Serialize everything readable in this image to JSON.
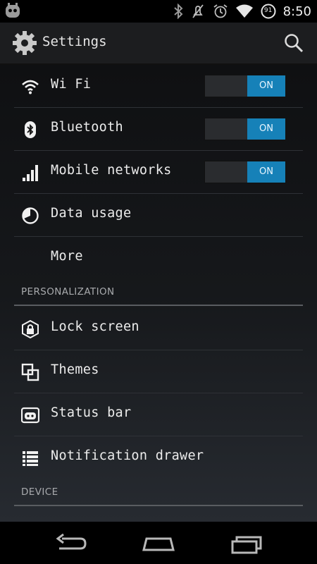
{
  "status_bar": {
    "battery_level": "91",
    "time": "8:50",
    "icons": [
      "cyanogen-icon",
      "bluetooth-icon",
      "mute-icon",
      "alarm-icon",
      "wifi-icon",
      "battery-icon"
    ]
  },
  "action_bar": {
    "title": "Settings",
    "app_icon": "gear-icon",
    "search_icon": "search-icon"
  },
  "wireless": {
    "items": [
      {
        "label": "Wi Fi",
        "icon": "wifi-icon",
        "toggle": "ON"
      },
      {
        "label": "Bluetooth",
        "icon": "bluetooth-icon",
        "toggle": "ON"
      },
      {
        "label": "Mobile networks",
        "icon": "signal-icon",
        "toggle": "ON"
      },
      {
        "label": "Data usage",
        "icon": "data-usage-icon"
      },
      {
        "label": "More"
      }
    ]
  },
  "personalization": {
    "header": "PERSONALIZATION",
    "items": [
      {
        "label": "Lock screen",
        "icon": "lock-icon"
      },
      {
        "label": "Themes",
        "icon": "themes-icon"
      },
      {
        "label": "Status bar",
        "icon": "status-bar-icon"
      },
      {
        "label": "Notification drawer",
        "icon": "list-icon"
      }
    ]
  },
  "device": {
    "header": "DEVICE"
  },
  "nav_bar": {
    "icons": [
      "back-icon",
      "home-icon",
      "recents-icon"
    ]
  },
  "colors": {
    "accent": "#1681b8",
    "background_top": "#0f1012",
    "background_bottom": "#272b31",
    "divider": "#2e3136"
  }
}
